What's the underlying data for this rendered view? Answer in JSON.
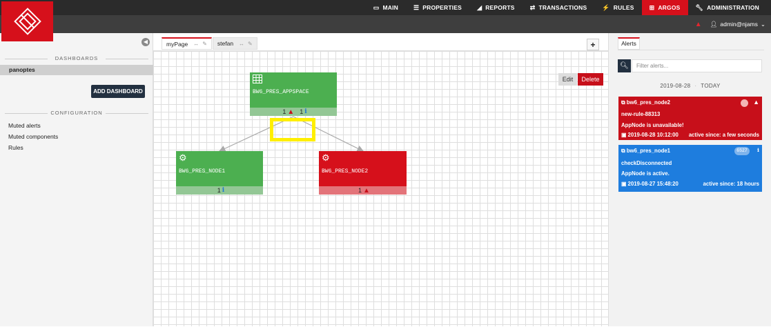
{
  "nav": {
    "items": [
      {
        "label": "MAIN",
        "icon": "monitor-icon"
      },
      {
        "label": "PROPERTIES",
        "icon": "list-icon"
      },
      {
        "label": "REPORTS",
        "icon": "chart-icon"
      },
      {
        "label": "TRANSACTIONS",
        "icon": "transfer-icon"
      },
      {
        "label": "RULES",
        "icon": "bolt-icon"
      },
      {
        "label": "ARGOS",
        "icon": "grid-icon"
      },
      {
        "label": "ADMINISTRATION",
        "icon": "wrench-icon"
      }
    ],
    "active": "ARGOS"
  },
  "user": {
    "name": "admin@njams"
  },
  "sidebar": {
    "dashboards_heading": "DASHBOARDS",
    "selected_dashboard": "panoptes",
    "add_button": "ADD DASHBOARD",
    "configuration_heading": "CONFIGURATION",
    "config_links": [
      "Muted alerts",
      "Muted components",
      "Rules"
    ]
  },
  "tabs": [
    {
      "label": "myPage",
      "active": true
    },
    {
      "label": "stefan",
      "active": false
    }
  ],
  "toolbar": {
    "plus": "+",
    "edit": "Edit",
    "delete": "Delete"
  },
  "nodes": {
    "appspace": {
      "label": "BW6_PRES_APPSPACE",
      "status": "green",
      "icon": "grid-icon",
      "error_count": "1",
      "info_count": "1"
    },
    "node1": {
      "label": "BW6_PRES_NODE1",
      "status": "green",
      "icon": "gear-icon",
      "info_count": "1"
    },
    "node2": {
      "label": "BW6_PRES_NODE2",
      "status": "red",
      "icon": "gear-icon",
      "error_count": "1"
    }
  },
  "alerts_panel": {
    "tab": "Alerts",
    "search_placeholder": "Filter alerts...",
    "date": "2019-08-28",
    "today": "TODAY",
    "alerts": [
      {
        "component": "bw6_pres_node2",
        "rule": "new-rule-88313",
        "message": "AppNode is unavailable!",
        "timestamp": "2019-08-28 10:12:00",
        "active_since": "active since: a few seconds",
        "color": "#c70f1a"
      },
      {
        "component": "bw6_pres_node1",
        "rule": "checkDisconnected",
        "message": "AppNode is active.",
        "timestamp": "2019-08-27 15:48:20",
        "active_since": "active since: 18 hours",
        "badge": "6527",
        "color": "#1e7dde"
      }
    ]
  },
  "colors": {
    "accent": "#d6101b",
    "ok": "#4caf50",
    "info": "#1e7dde",
    "highlight": "#ffef00"
  }
}
